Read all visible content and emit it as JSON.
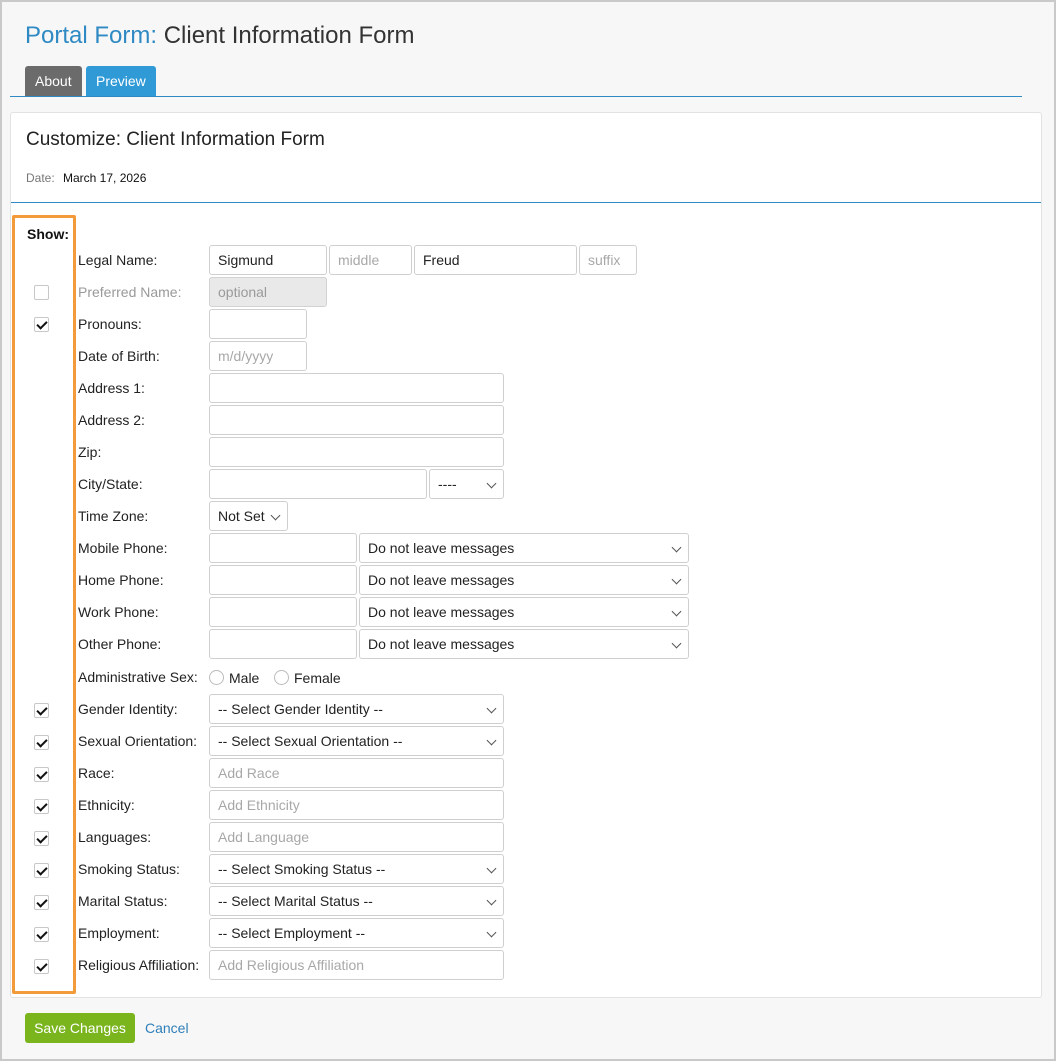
{
  "header": {
    "crumb": "Portal Form",
    "separator": ":",
    "title": " Client Information Form"
  },
  "tabs": [
    {
      "label": "About"
    },
    {
      "label": "Preview"
    }
  ],
  "card": {
    "title": "Customize: Client Information Form",
    "date_label": "Date:",
    "date_value": "March 17, 2026"
  },
  "show_label": "Show:",
  "fields": {
    "legal_name": {
      "label": "Legal Name:",
      "first": "Sigmund",
      "middle_placeholder": "middle",
      "last": "Freud",
      "suffix_placeholder": "suffix"
    },
    "preferred_name": {
      "label": "Preferred Name:",
      "placeholder": "optional",
      "checked": false
    },
    "pronouns": {
      "label": "Pronouns:",
      "checked": true
    },
    "dob": {
      "label": "Date of Birth:",
      "placeholder": "m/d/yyyy"
    },
    "address1": {
      "label": "Address 1:"
    },
    "address2": {
      "label": "Address 2:"
    },
    "zip": {
      "label": "Zip:"
    },
    "city_state": {
      "label": "City/State:",
      "state_value": "----"
    },
    "time_zone": {
      "label": "Time Zone:",
      "value": "Not Set"
    },
    "mobile_phone": {
      "label": "Mobile Phone:",
      "message_option": "Do not leave messages"
    },
    "home_phone": {
      "label": "Home Phone:",
      "message_option": "Do not leave messages"
    },
    "work_phone": {
      "label": "Work Phone:",
      "message_option": "Do not leave messages"
    },
    "other_phone": {
      "label": "Other Phone:",
      "message_option": "Do not leave messages"
    },
    "admin_sex": {
      "label": "Administrative Sex:",
      "options": [
        "Male",
        "Female"
      ]
    },
    "gender_identity": {
      "label": "Gender Identity:",
      "value": "-- Select Gender Identity --",
      "checked": true
    },
    "sexual_orientation": {
      "label": "Sexual Orientation:",
      "value": "-- Select Sexual Orientation --",
      "checked": true
    },
    "race": {
      "label": "Race:",
      "placeholder": "Add Race",
      "checked": true
    },
    "ethnicity": {
      "label": "Ethnicity:",
      "placeholder": "Add Ethnicity",
      "checked": true
    },
    "languages": {
      "label": "Languages:",
      "placeholder": "Add Language",
      "checked": true
    },
    "smoking_status": {
      "label": "Smoking Status:",
      "value": "-- Select Smoking Status --",
      "checked": true
    },
    "marital_status": {
      "label": "Marital Status:",
      "value": "-- Select Marital Status --",
      "checked": true
    },
    "employment": {
      "label": "Employment:",
      "value": "-- Select Employment --",
      "checked": true
    },
    "religious_affiliation": {
      "label": "Religious Affiliation:",
      "placeholder": "Add Religious Affiliation",
      "checked": true
    }
  },
  "actions": {
    "save_label": "Save Changes",
    "cancel_label": "Cancel"
  },
  "colors": {
    "accent": "#2f8ac4",
    "highlight_box": "#f39a3a",
    "save_button": "#7ab51d"
  }
}
